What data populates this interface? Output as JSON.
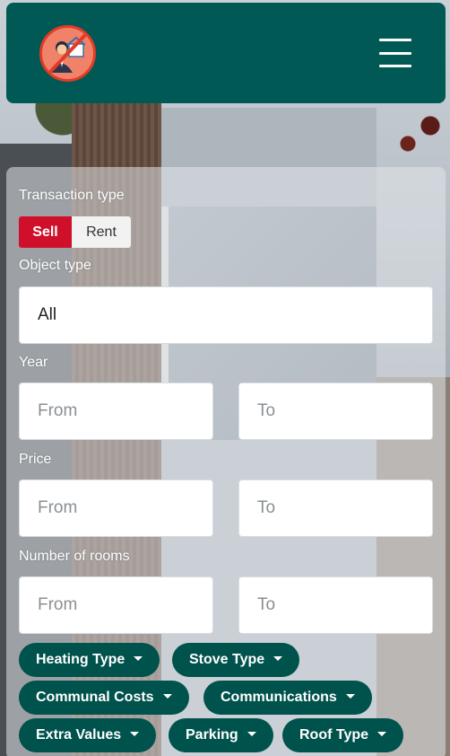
{
  "navbar": {
    "logo_icon": "no-realtor-logo-icon",
    "menu_icon": "hamburger-menu-icon",
    "brand_color": "#005954"
  },
  "filters": {
    "transaction_type": {
      "label": "Transaction type",
      "options": [
        "Sell",
        "Rent"
      ],
      "selected": "Sell"
    },
    "object_type": {
      "label": "Object type",
      "value": "All"
    },
    "year": {
      "label": "Year",
      "from_placeholder": "From",
      "to_placeholder": "To"
    },
    "price": {
      "label": "Price",
      "from_placeholder": "From",
      "to_placeholder": "To"
    },
    "rooms": {
      "label": "Number of rooms",
      "from_placeholder": "From",
      "to_placeholder": "To"
    },
    "dropdowns": [
      "Heating Type",
      "Stove Type",
      "Communal Costs",
      "Communications",
      "Extra Values",
      "Parking",
      "Roof Type"
    ]
  },
  "colors": {
    "accent_red": "#d0102a",
    "chip_green": "#00524c"
  }
}
